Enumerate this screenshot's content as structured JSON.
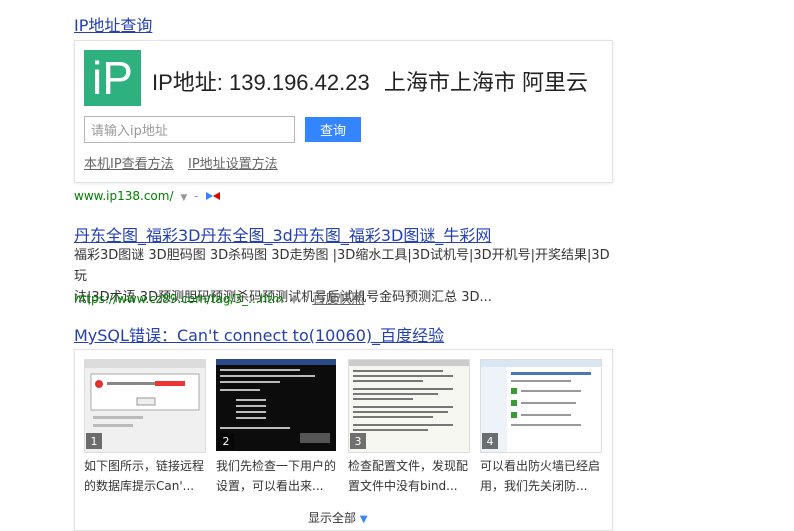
{
  "ip_block": {
    "heading": "IP地址查询",
    "logo_text": "iP",
    "result_label": "IP地址: 139.196.42.23",
    "location": "上海市上海市 阿里云",
    "input_placeholder": "请输入ip地址",
    "query_button": "查询",
    "link1": "本机IP查看方法",
    "link2": "IP地址设置方法",
    "source_url": "www.ip138.com/",
    "source_sep": "-"
  },
  "result2": {
    "title": "丹东全图_福彩3D丹东全图_3d丹东图_福彩3D图谜_牛彩网",
    "snippet_line1": "福彩3D图谜 3D胆码图 3D杀码图 3D走势图 |3D缩水工具|3D试机号|3D开机号|开奖结果|3D玩",
    "snippet_line2": "法|3D术语 3D预测胆码预测杀码预测试机号后试机号金码预测汇总 3D...",
    "url": "https://www.cz89.com/tag/3_...htm",
    "sep": "-",
    "cache_link": "百度快照"
  },
  "result3": {
    "title": "MySQL错误：Can't connect to(10060)_百度经验",
    "steps": [
      {
        "num": "1",
        "line1": "如下图所示，链接远程",
        "line2": "的数据库提示Can'..."
      },
      {
        "num": "2",
        "line1": "我们先检查一下用户的",
        "line2": "设置，可以看出来..."
      },
      {
        "num": "3",
        "line1": "检查配置文件，发现配",
        "line2": "置文件中没有bind..."
      },
      {
        "num": "4",
        "line1": "可以看出防火墙已经启",
        "line2": "用，我们先关闭防..."
      }
    ],
    "show_all": "显示全部"
  },
  "colors": {
    "link": "#2440b3",
    "url_green": "#008000",
    "button": "#3385ff",
    "logo": "#2eb07f"
  }
}
